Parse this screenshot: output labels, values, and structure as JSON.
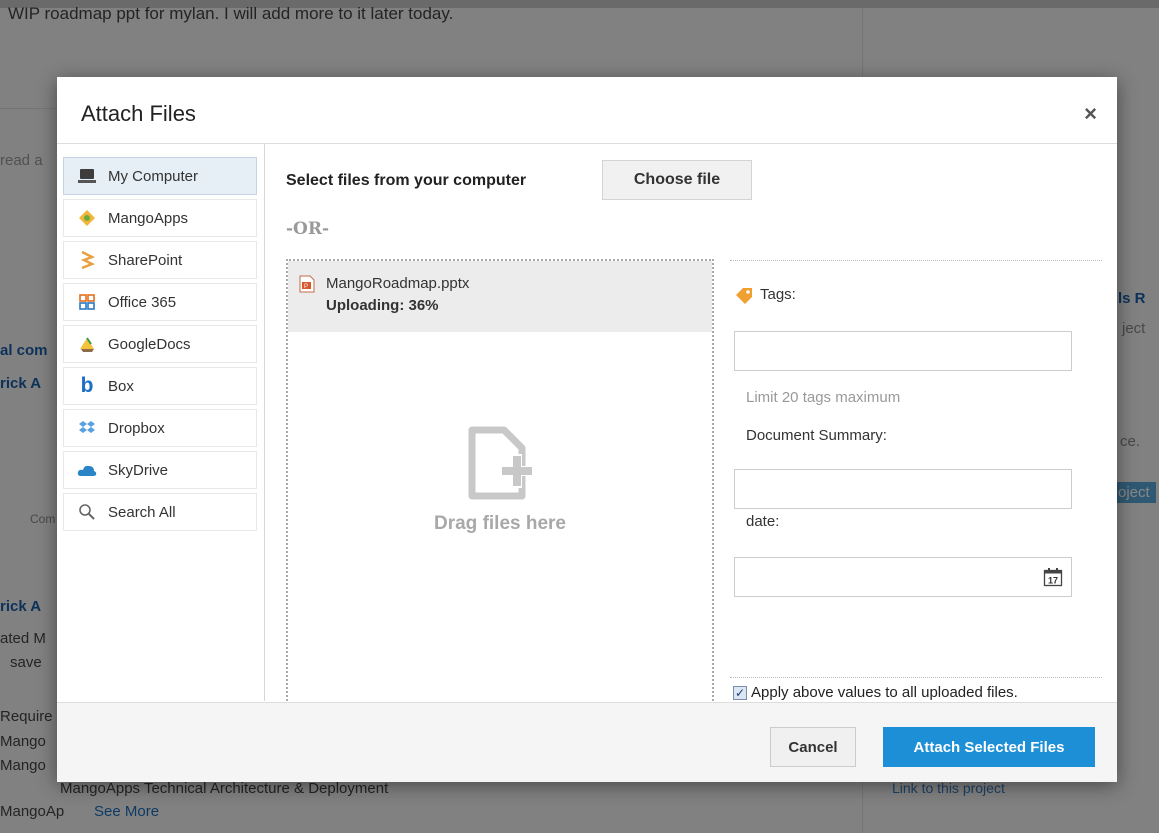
{
  "background": {
    "top_text": "WIP roadmap ppt for mylan. I will add more to it later today.",
    "left_snippets": [
      "read a",
      "al com",
      "rick A",
      "Com",
      "rick A",
      "ated M",
      "save",
      "Require",
      "Mango",
      "Mango",
      "MangoAp"
    ],
    "bottom_line": "MangoApps Technical Architecture & Deployment",
    "see_more": "See More",
    "right_snippets": [
      "ls R",
      "ject",
      "ce.",
      "oject"
    ],
    "link_project": "Link to this project"
  },
  "dialog": {
    "title": "Attach Files",
    "close_glyph": "×",
    "sources": [
      {
        "label": "My Computer",
        "icon": "computer-icon",
        "active": true
      },
      {
        "label": "MangoApps",
        "icon": "mangoapps-icon",
        "active": false
      },
      {
        "label": "SharePoint",
        "icon": "sharepoint-icon",
        "active": false
      },
      {
        "label": "Office 365",
        "icon": "office365-icon",
        "active": false
      },
      {
        "label": "GoogleDocs",
        "icon": "googledocs-icon",
        "active": false
      },
      {
        "label": "Box",
        "icon": "box-icon",
        "active": false
      },
      {
        "label": "Dropbox",
        "icon": "dropbox-icon",
        "active": false
      },
      {
        "label": "SkyDrive",
        "icon": "skydrive-icon",
        "active": false
      },
      {
        "label": "Search All",
        "icon": "search-icon",
        "active": false
      }
    ],
    "select_label": "Select files from your computer",
    "choose_file": "Choose file",
    "or_label": "-OR-",
    "file": {
      "name": "MangoRoadmap.pptx",
      "status": "Uploading: 36%",
      "progress": 36
    },
    "drop_text": "Drag files here",
    "tags_label": "Tags:",
    "tags_hint": "Limit 20 tags maximum",
    "summary_label": "Document Summary:",
    "date_label": "date:",
    "calendar_day": "17",
    "apply_label": "Apply above values to all uploaded files.",
    "apply_checked": true,
    "cancel": "Cancel",
    "attach": "Attach Selected Files"
  },
  "colors": {
    "accent": "#1d8fd6",
    "active_source_bg": "#e6eef6"
  }
}
